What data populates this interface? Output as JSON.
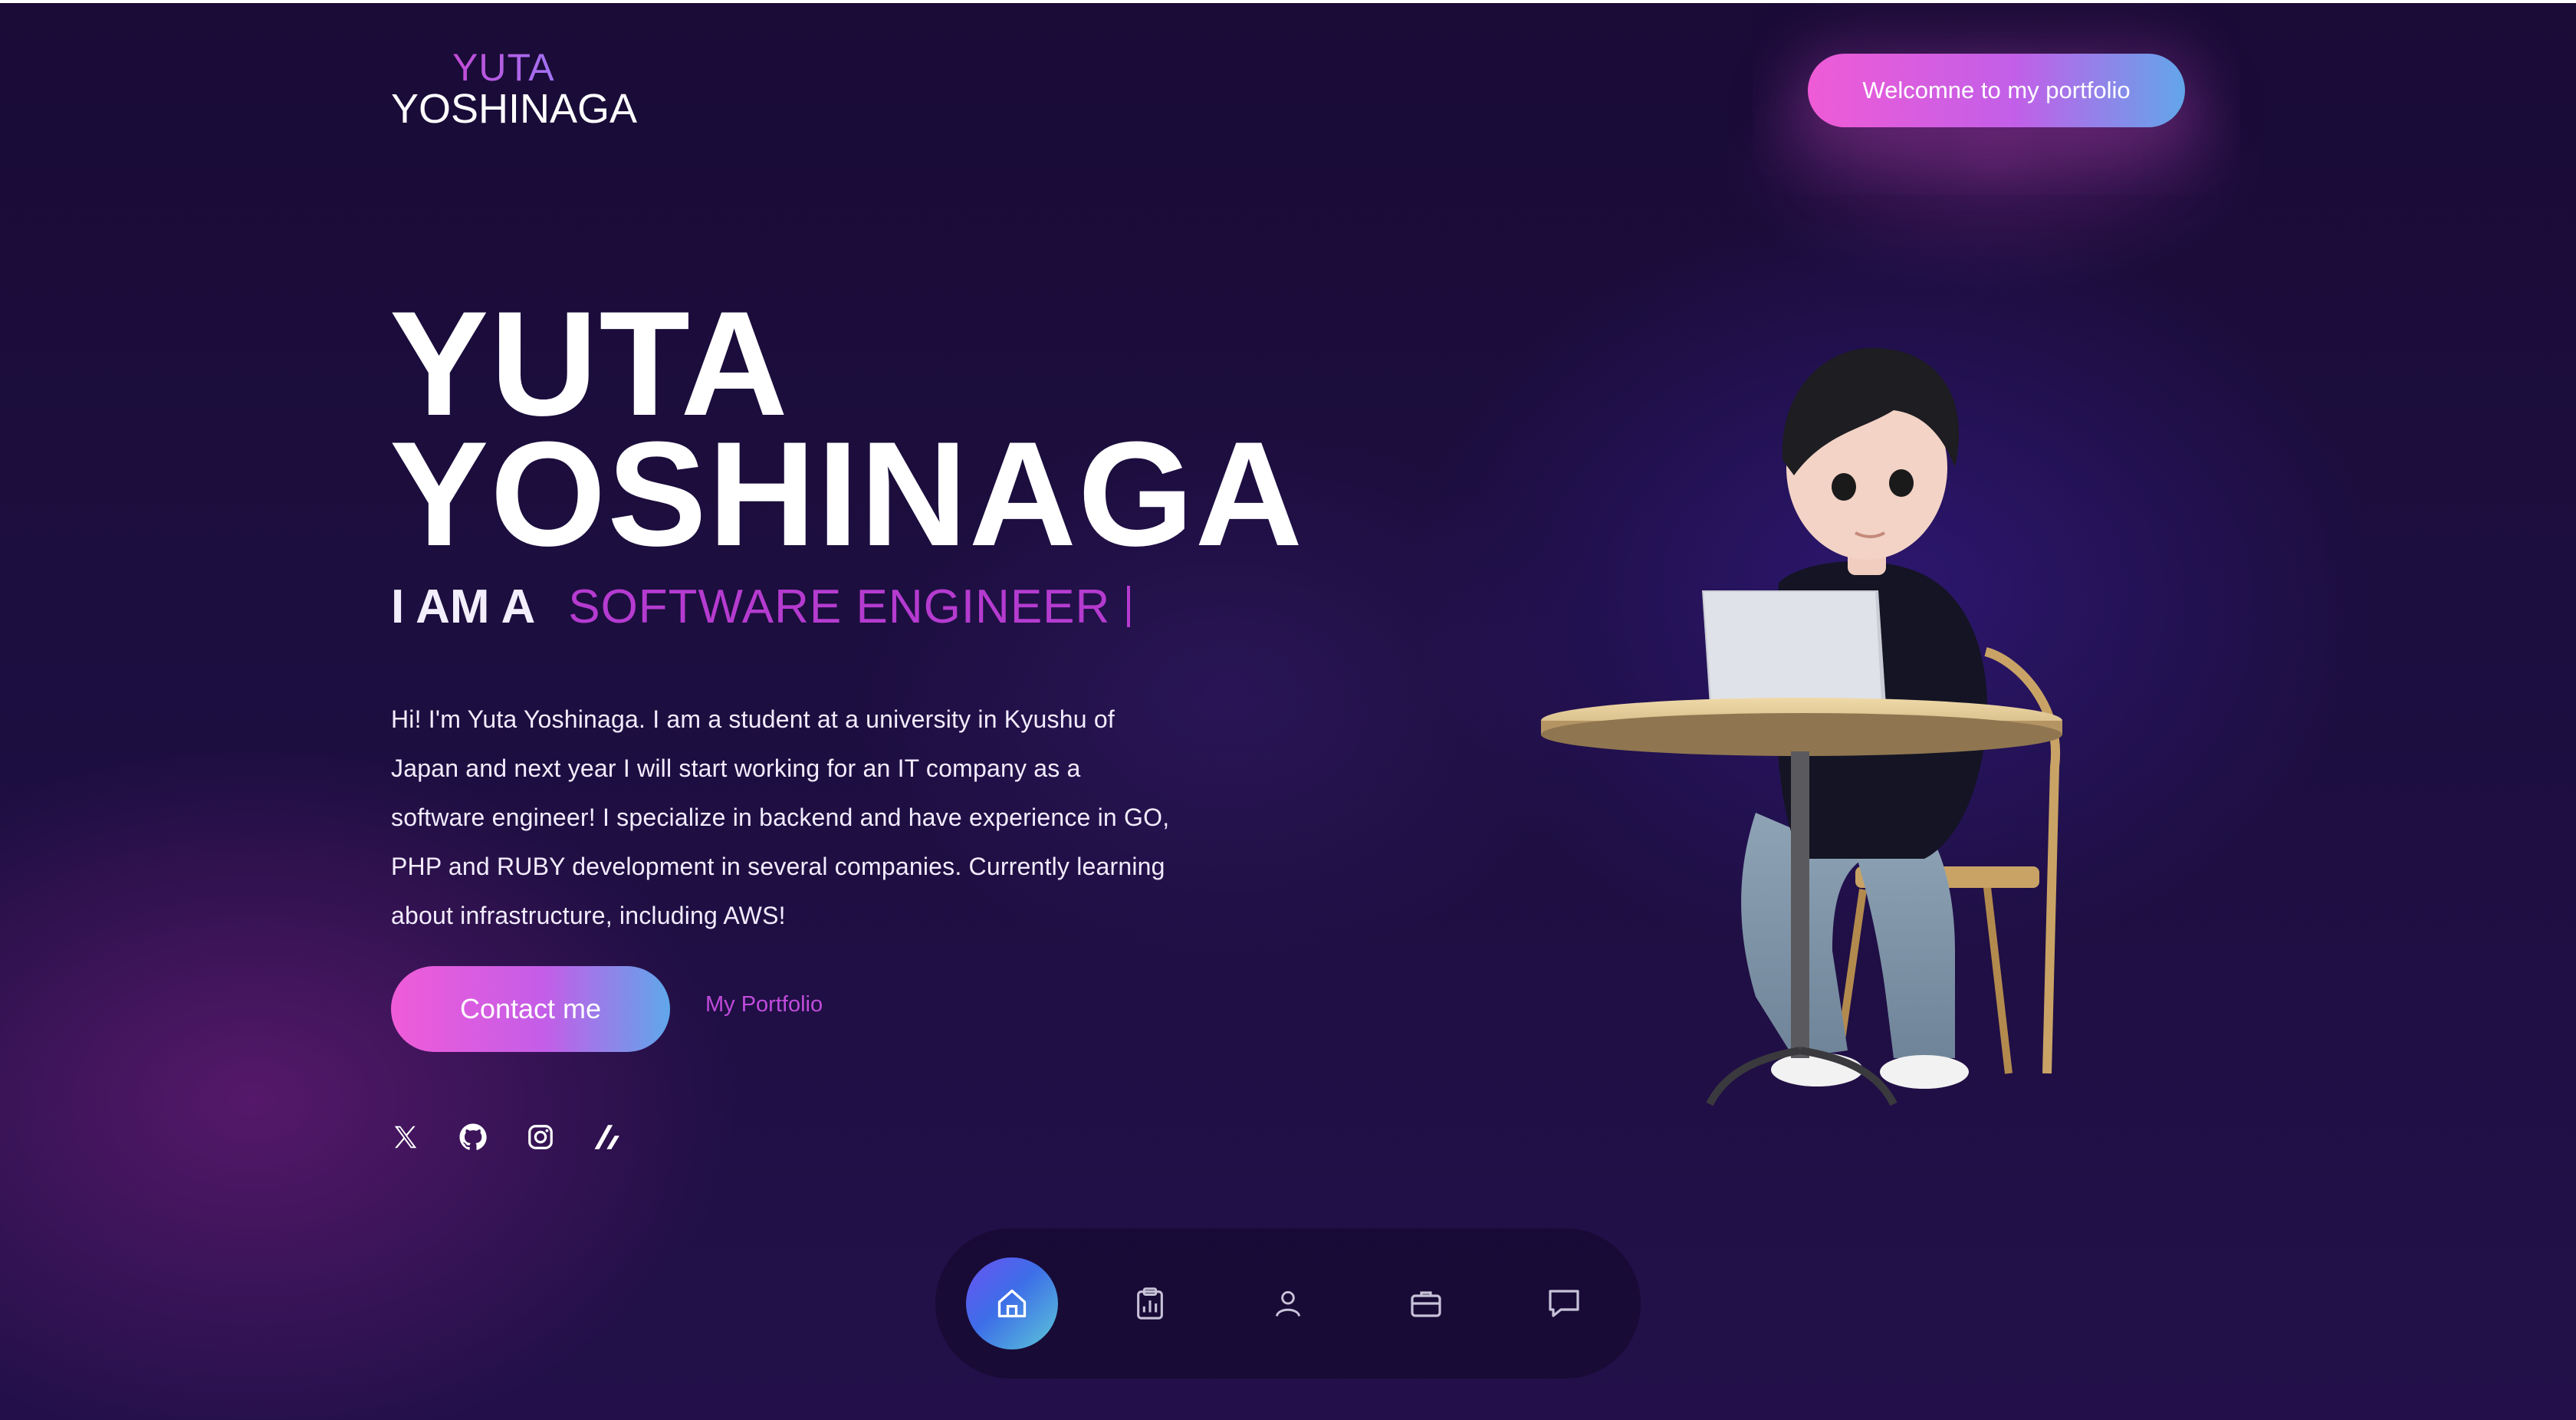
{
  "header": {
    "logo_top": "YUTA",
    "logo_bottom": "YOSHINAGA",
    "welcome_label": "Welcomne to my portfolio"
  },
  "hero": {
    "name_line1": "YUTA",
    "name_line2": "YOSHINAGA",
    "role_prefix": "I AM A",
    "role_title": "SOFTWARE ENGINEER",
    "bio": "Hi! I'm Yuta Yoshinaga. I am a student at a university in Kyushu of Japan and next year I will start working for an IT company as a software engineer! I specialize in backend and have experience in GO, PHP and RUBY development in several companies. Currently learning about infrastructure, including AWS!",
    "contact_label": "Contact me",
    "portfolio_label": "My Portfolio"
  },
  "socials": [
    "x-icon",
    "github-icon",
    "instagram-icon",
    "zenn-icon"
  ],
  "bottom_nav": {
    "items": [
      "home-icon",
      "clipboard-chart-icon",
      "user-icon",
      "briefcase-icon",
      "chat-icon"
    ],
    "active_index": 0
  },
  "colors": {
    "background": "#1b0d3a",
    "accent_pink": "#ef5bd6",
    "accent_purple": "#b53bd0",
    "accent_blue": "#62a6ea"
  }
}
